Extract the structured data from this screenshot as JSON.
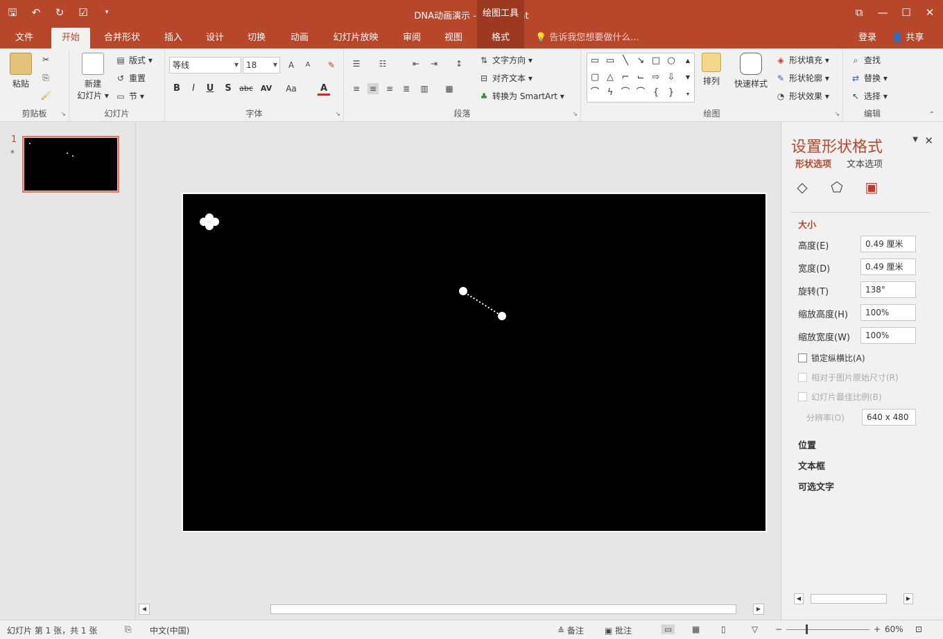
{
  "titlebar": {
    "title": "DNA动画演示 - PowerPoint",
    "context_label": "绘图工具",
    "qat_save": "🖫",
    "qat_undo": "↶",
    "qat_redo": "↻",
    "qat_custom": "☑",
    "qat_more": "▾",
    "win_ribbon": "⧉",
    "win_min": "—",
    "win_max": "☐",
    "win_close": "✕"
  },
  "tabs": {
    "items": [
      "文件",
      "开始",
      "合并形状",
      "插入",
      "设计",
      "切换",
      "动画",
      "幻灯片放映",
      "审阅",
      "视图",
      "格式"
    ],
    "active_index": 1,
    "tell_me": "告诉我您想要做什么...",
    "login": "登录",
    "share": "共享"
  },
  "ribbon": {
    "clipboard": {
      "label": "剪贴板",
      "paste": "粘贴"
    },
    "slides": {
      "label": "幻灯片",
      "new_slide": "新建",
      "new_slide2": "幻灯片 ▾",
      "layout": "版式 ▾",
      "reset": "重置",
      "section": "节 ▾"
    },
    "font": {
      "label": "字体",
      "font_name": "等线",
      "font_size": "18",
      "bold": "B",
      "italic": "I",
      "underline": "U",
      "shadow": "S",
      "strike": "abc",
      "spacing": "AV",
      "case": "Aa",
      "color": "A"
    },
    "paragraph": {
      "label": "段落",
      "text_direction": "文字方向 ▾",
      "align_text": "对齐文本 ▾",
      "smartart": "转换为 SmartArt ▾"
    },
    "drawing": {
      "label": "绘图",
      "arrange": "排列",
      "quick_styles": "快速样式",
      "fill": "形状填充 ▾",
      "outline": "形状轮廓 ▾",
      "effects": "形状效果 ▾"
    },
    "editing": {
      "label": "编辑",
      "find": "查找",
      "replace": "替换 ▾",
      "select": "选择 ▾"
    }
  },
  "thumbs": {
    "slide_number": "1",
    "star": "*"
  },
  "pane": {
    "title": "设置形状格式",
    "tab_shape": "形状选项",
    "tab_text": "文本选项",
    "section_size": "大小",
    "fields": [
      {
        "label": "高度(E)",
        "value": "0.49 厘米"
      },
      {
        "label": "宽度(D)",
        "value": "0.49 厘米"
      },
      {
        "label": "旋转(T)",
        "value": "138°"
      },
      {
        "label": "缩放高度(H)",
        "value": "100%"
      },
      {
        "label": "缩放宽度(W)",
        "value": "100%"
      }
    ],
    "lock_ratio": "锁定纵横比(A)",
    "relative_original": "相对于图片原始尺寸(R)",
    "best_scale": "幻灯片最佳比例(B)",
    "resolution_label": "分辨率(O)",
    "resolution_value": "640 x 480",
    "section_position": "位置",
    "section_textbox": "文本框",
    "section_alt": "可选文字"
  },
  "status": {
    "slide_info": "幻灯片 第 1 张，共 1 张",
    "language": "中文(中国)",
    "notes": "备注",
    "comments": "批注",
    "zoom": "60%"
  }
}
